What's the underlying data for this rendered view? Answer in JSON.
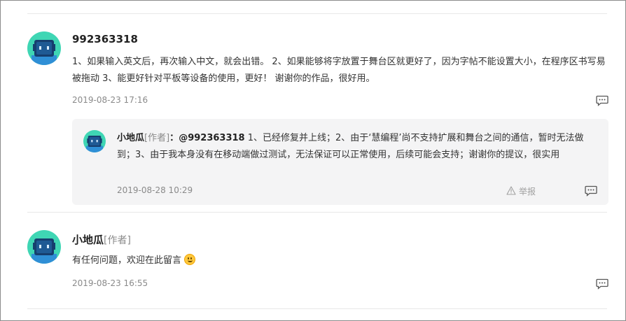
{
  "comments": [
    {
      "username": "992363318",
      "content": "1、如果输入英文后，再次输入中文，就会出错。 2、如果能够将字放置于舞台区就更好了，因为字帖不能设置大小，在程序区书写易被拖动 3、能更好针对平板等设备的使用，更好！ 谢谢你的作品，很好用。",
      "time": "2019-08-23 17:16",
      "reply_icon": "comment-icon",
      "reply": {
        "username": "小地瓜",
        "author_tag": "[作者]",
        "separator": "：",
        "mention": "@992363318",
        "content": " 1、已经修复并上线；2、由于‘慧编程’尚不支持扩展和舞台之间的通信，暂时无法做到；3、由于我本身没有在移动端做过测试，无法保证可以正常使用，后续可能会支持；谢谢你的提议，很实用",
        "time": "2019-08-28 10:29",
        "report_label": "举报",
        "report_icon": "warning-icon",
        "reply_icon": "comment-icon"
      }
    },
    {
      "username": "小地瓜",
      "author_tag": "[作者]",
      "content": "有任何问题，欢迎在此留言",
      "emoji": "smile-emoji",
      "time": "2019-08-23 16:55",
      "reply_icon": "comment-icon"
    }
  ],
  "colors": {
    "avatar_bg": "#3fd6b4",
    "avatar_face": "#1b4f8a",
    "reply_bg": "#f4f4f5",
    "muted_text": "#8a8a8a"
  }
}
